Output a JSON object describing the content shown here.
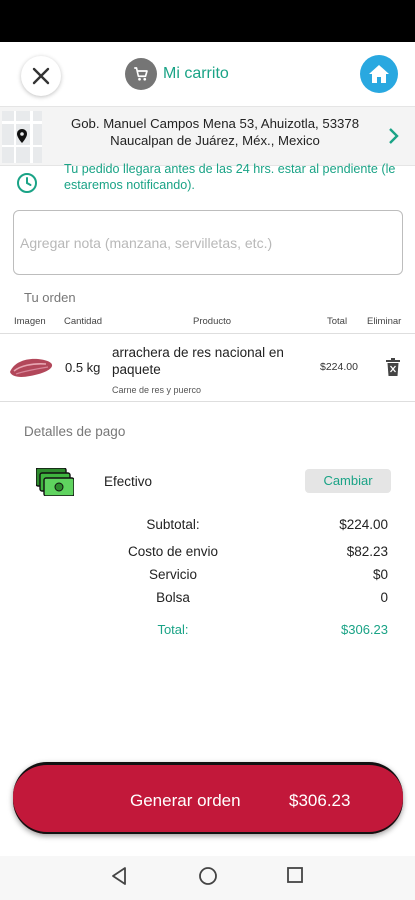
{
  "header": {
    "cart_title": "Mi carrito",
    "close_icon": "close-icon",
    "cart_icon": "shopping-cart-icon",
    "home_icon": "home-icon",
    "accent": "#1aa386",
    "home_color": "#29a8e0"
  },
  "address": {
    "line1": "Gob. Manuel Campos Mena 53, Ahuizotla, 53378",
    "line2": "Naucalpan de Juárez, Méx., Mexico"
  },
  "notice": {
    "text": "Tu pedido llegara antes de las 24 hrs. estar al pendiente (le estaremos notificando)."
  },
  "note": {
    "placeholder": "Agregar nota (manzana, servilletas, etc.)"
  },
  "order": {
    "section_label": "Tu orden",
    "columns": [
      "Imagen",
      "Cantidad",
      "Producto",
      "Total",
      "Eliminar"
    ],
    "items": [
      {
        "quantity": "0.5 kg",
        "name": "arrachera de res nacional en paquete",
        "category": "Carne de res y puerco",
        "total": "$224.00"
      }
    ]
  },
  "payment": {
    "section_label": "Detalles de pago",
    "method": "Efectivo",
    "change_label": "Cambiar",
    "summary": {
      "subtotal_label": "Subtotal:",
      "subtotal": "$224.00",
      "shipping_label": "Costo de envio",
      "shipping": "$82.23",
      "service_label": "Servicio",
      "service": "$0",
      "bag_label": "Bolsa",
      "bag": "0",
      "total_label": "Total:",
      "total": "$306.23"
    }
  },
  "footer": {
    "generate_label": "Generar orden",
    "generate_total": "$306.23",
    "button_color": "#c2183a"
  }
}
